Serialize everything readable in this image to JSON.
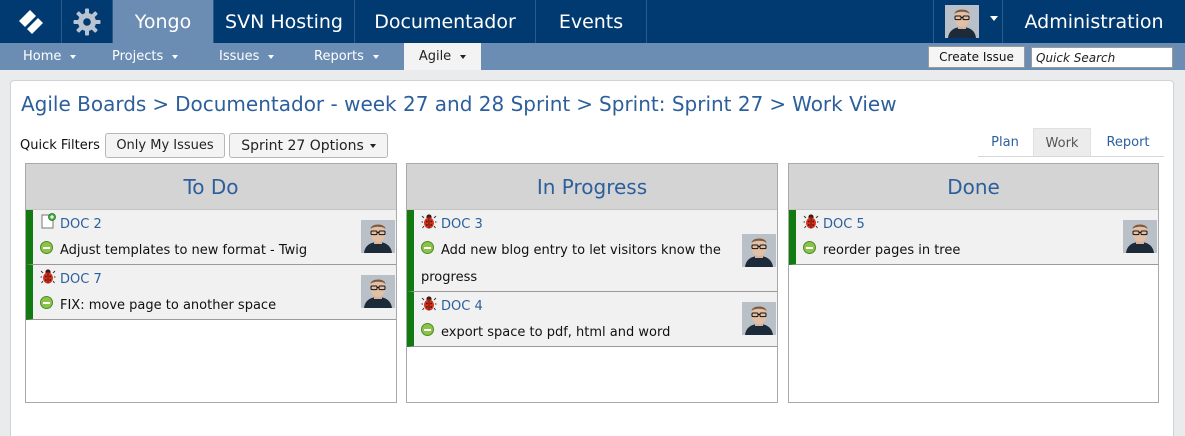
{
  "topnav": {
    "logo_icon": "yongo-logo-icon",
    "settings_icon": "gear-icon",
    "tabs": [
      {
        "label": "Yongo",
        "active": true
      },
      {
        "label": "SVN Hosting",
        "active": false
      },
      {
        "label": "Documentador",
        "active": false
      },
      {
        "label": "Events",
        "active": false
      }
    ],
    "user_avatar": "user-avatar",
    "admin_label": "Administration"
  },
  "subnav": {
    "items": [
      {
        "label": "Home",
        "active": false
      },
      {
        "label": "Projects",
        "active": false
      },
      {
        "label": "Issues",
        "active": false
      },
      {
        "label": "Reports",
        "active": false
      },
      {
        "label": "Agile",
        "active": true
      }
    ],
    "create_issue_label": "Create Issue",
    "search_placeholder": "Quick Search"
  },
  "breadcrumb": {
    "items": [
      "Agile Boards",
      "Documentador - week 27 and 28 Sprint",
      "Sprint: Sprint 27",
      "Work View"
    ],
    "separator": ">"
  },
  "filters": {
    "label": "Quick Filters",
    "only_my_issues": "Only My Issues",
    "sprint_options": "Sprint 27 Options"
  },
  "views": [
    {
      "label": "Plan",
      "active": false
    },
    {
      "label": "Work",
      "active": true
    },
    {
      "label": "Report",
      "active": false
    }
  ],
  "colors": {
    "topbar": "#003a70",
    "subbar": "#6b8db3",
    "link": "#2c5f9c",
    "card_accent": "#117a11"
  },
  "columns": [
    {
      "title": "To Do",
      "cards": [
        {
          "key": "DOC 2",
          "type_icon": "new-feature-icon",
          "priority_icon": "minor-priority-icon",
          "summary": "Adjust templates to new format - Twig"
        },
        {
          "key": "DOC 7",
          "type_icon": "bug-icon",
          "priority_icon": "minor-priority-icon",
          "summary": "FIX: move page to another space"
        }
      ]
    },
    {
      "title": "In Progress",
      "cards": [
        {
          "key": "DOC 3",
          "type_icon": "bug-icon",
          "priority_icon": "minor-priority-icon",
          "summary": "Add new blog entry to let visitors know the progress"
        },
        {
          "key": "DOC 4",
          "type_icon": "bug-icon",
          "priority_icon": "minor-priority-icon",
          "summary": "export space to pdf, html and word"
        }
      ]
    },
    {
      "title": "Done",
      "cards": [
        {
          "key": "DOC 5",
          "type_icon": "bug-icon",
          "priority_icon": "minor-priority-icon",
          "summary": "reorder pages in tree"
        }
      ]
    }
  ]
}
